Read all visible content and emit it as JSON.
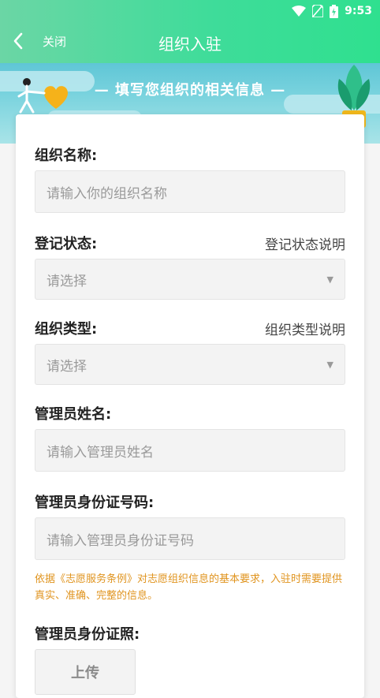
{
  "status_bar": {
    "time": "9:53"
  },
  "header": {
    "close_label": "关闭",
    "title": "组织入驻"
  },
  "banner": {
    "text": "— 填写您组织的相关信息 —"
  },
  "form": {
    "org_name": {
      "label": "组织名称:",
      "placeholder": "请输入你的组织名称"
    },
    "reg_status": {
      "label": "登记状态:",
      "help": "登记状态说明",
      "value": "请选择"
    },
    "org_type": {
      "label": "组织类型:",
      "help": "组织类型说明",
      "value": "请选择"
    },
    "admin_name": {
      "label": "管理员姓名:",
      "placeholder": "请输入管理员姓名"
    },
    "admin_id": {
      "label": "管理员身份证号码:",
      "placeholder": "请输入管理员身份证号码"
    },
    "notice": "依据《志愿服务条例》对志愿组织信息的基本要求，入驻时需要提供真实、准确、完整的信息。",
    "admin_id_photo": {
      "label": "管理员身份证照:",
      "upload_label": "上传"
    }
  }
}
